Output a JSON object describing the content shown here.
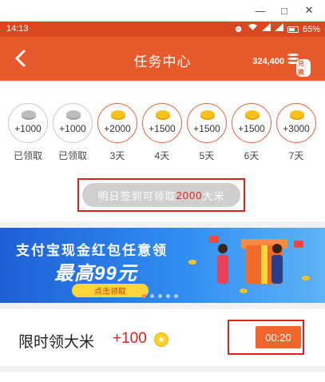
{
  "window": {
    "minimize_glyph": "—",
    "maximize_glyph": "□",
    "close_glyph": "✕"
  },
  "status_bar": {
    "time": "14:13",
    "battery": "65%",
    "icons": [
      "alarm-icon",
      "wifi-icon",
      "signal-icon",
      "signal-icon",
      "battery-icon"
    ]
  },
  "header": {
    "title": "任务中心",
    "points": "324,400",
    "exchange_label": "兑换",
    "back_icon": "back-arrow-icon"
  },
  "signin": {
    "days": [
      {
        "amount": "+1000",
        "label": "已领取",
        "state": "claimed"
      },
      {
        "amount": "+1000",
        "label": "已领取",
        "state": "claimed"
      },
      {
        "amount": "+2000",
        "label": "3天",
        "state": "future"
      },
      {
        "amount": "+1500",
        "label": "4天",
        "state": "future"
      },
      {
        "amount": "+1500",
        "label": "5天",
        "state": "future"
      },
      {
        "amount": "+1500",
        "label": "6天",
        "state": "future"
      },
      {
        "amount": "+3000",
        "label": "7天",
        "state": "future"
      }
    ],
    "tomorrow_prefix": "明日签到可领取",
    "tomorrow_amount": "2000",
    "tomorrow_suffix": "大米"
  },
  "banner": {
    "headline": "支付宝现金红包任意领",
    "big_text": "最高99元",
    "cta_label": "点击领取",
    "page_count": 5,
    "active_page": 0
  },
  "task": {
    "name": "限时领大米",
    "reward": "+100",
    "timer": "00:20"
  },
  "colors": {
    "brand": "#e65a2c",
    "status_bar": "#d9481f",
    "highlight_red": "#e0201a",
    "gold": "#f7c21d"
  }
}
